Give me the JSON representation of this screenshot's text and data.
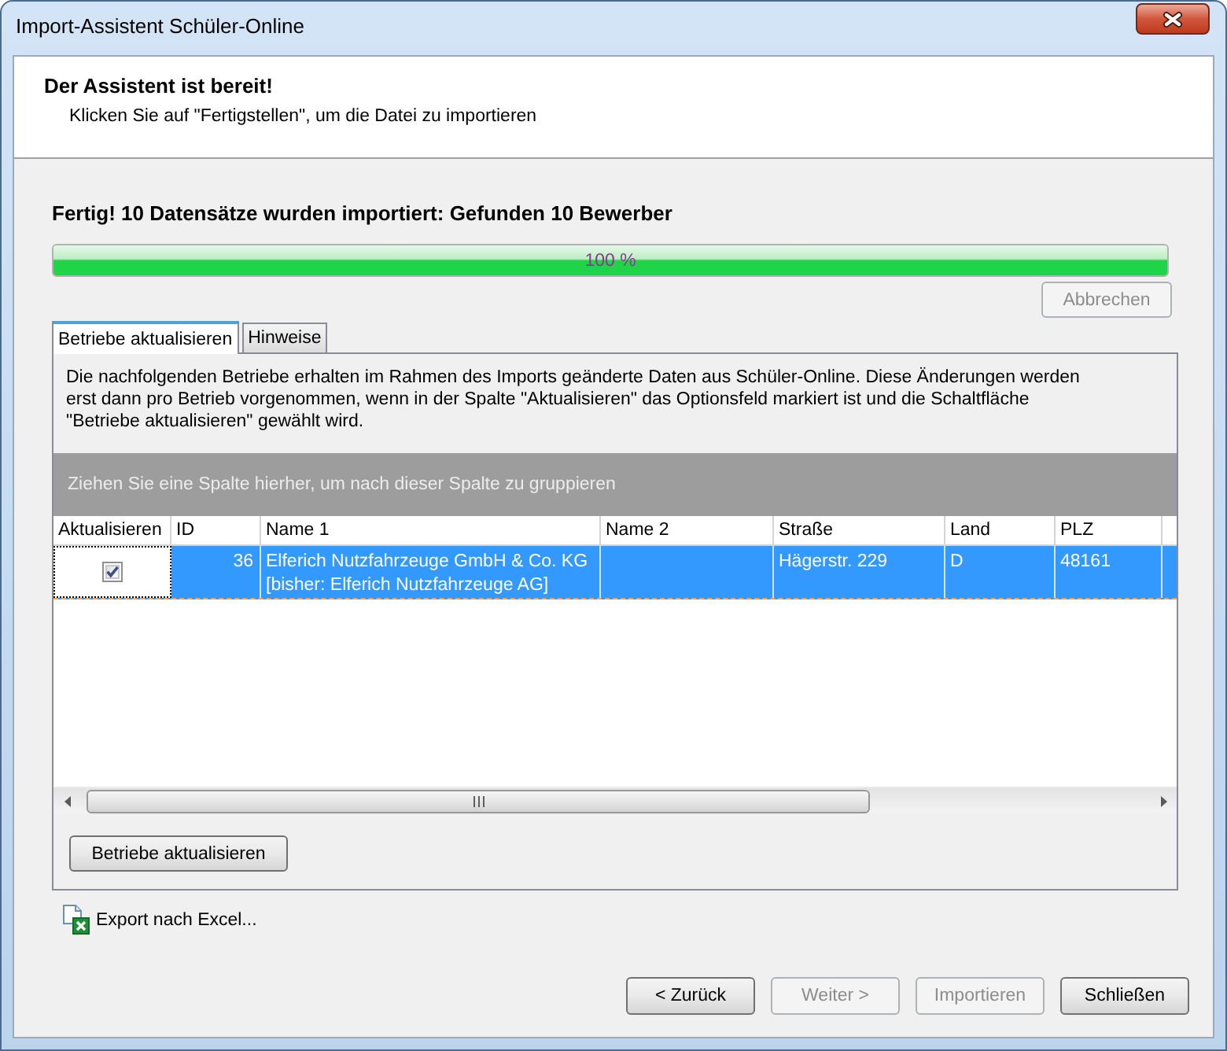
{
  "window": {
    "title": "Import-Assistent Schüler-Online"
  },
  "header": {
    "title": "Der Assistent ist bereit!",
    "subtitle": "Klicken Sie auf \"Fertigstellen\", um die Datei zu importieren"
  },
  "status": {
    "message": "Fertig! 10 Datensätze wurden importiert: Gefunden 10 Bewerber",
    "progress": {
      "level": 1,
      "reading": "100 %"
    },
    "cancel_button": {
      "label": "Abbrechen",
      "disabled": true
    }
  },
  "tabs": [
    {
      "label": "Betriebe aktualisieren",
      "selected": true
    },
    {
      "label": "Hinweise",
      "selected": false
    }
  ],
  "panel": {
    "description": "Die nachfolgenden Betriebe erhalten im Rahmen des Imports geänderte Daten aus Schüler-Online. Diese Änderungen werden erst dann pro Betrieb vorgenommen, wenn in der Spalte \"Aktualisieren\" das Optionsfeld markiert ist und die Schaltfläche \"Betriebe aktualisieren\" gewählt wird.",
    "group_hint": "Ziehen Sie eine Spalte hierher, um nach dieser Spalte zu gruppieren",
    "table": {
      "columns": [
        "Aktualisieren",
        "ID",
        "Name 1",
        "Name 2",
        "Straße",
        "Land",
        "PLZ"
      ],
      "rows": [
        {
          "selected": true,
          "checked": true,
          "cells": [
            "",
            "36",
            "Elferich Nutzfahrzeuge GmbH & Co. KG\n[bisher: Elferich Nutzfahrzeuge AG]",
            "",
            "Hägerstr. 229",
            "D",
            "48161"
          ]
        }
      ]
    },
    "update_button": {
      "label": "Betriebe aktualisieren",
      "disabled": false
    }
  },
  "export_link": "Export nach Excel...",
  "buttons": [
    {
      "label": "< Zurück",
      "disabled": false
    },
    {
      "label": "Weiter >",
      "disabled": true
    },
    {
      "label": "Importieren",
      "disabled": true
    },
    {
      "label": "Schließen",
      "disabled": false
    }
  ]
}
